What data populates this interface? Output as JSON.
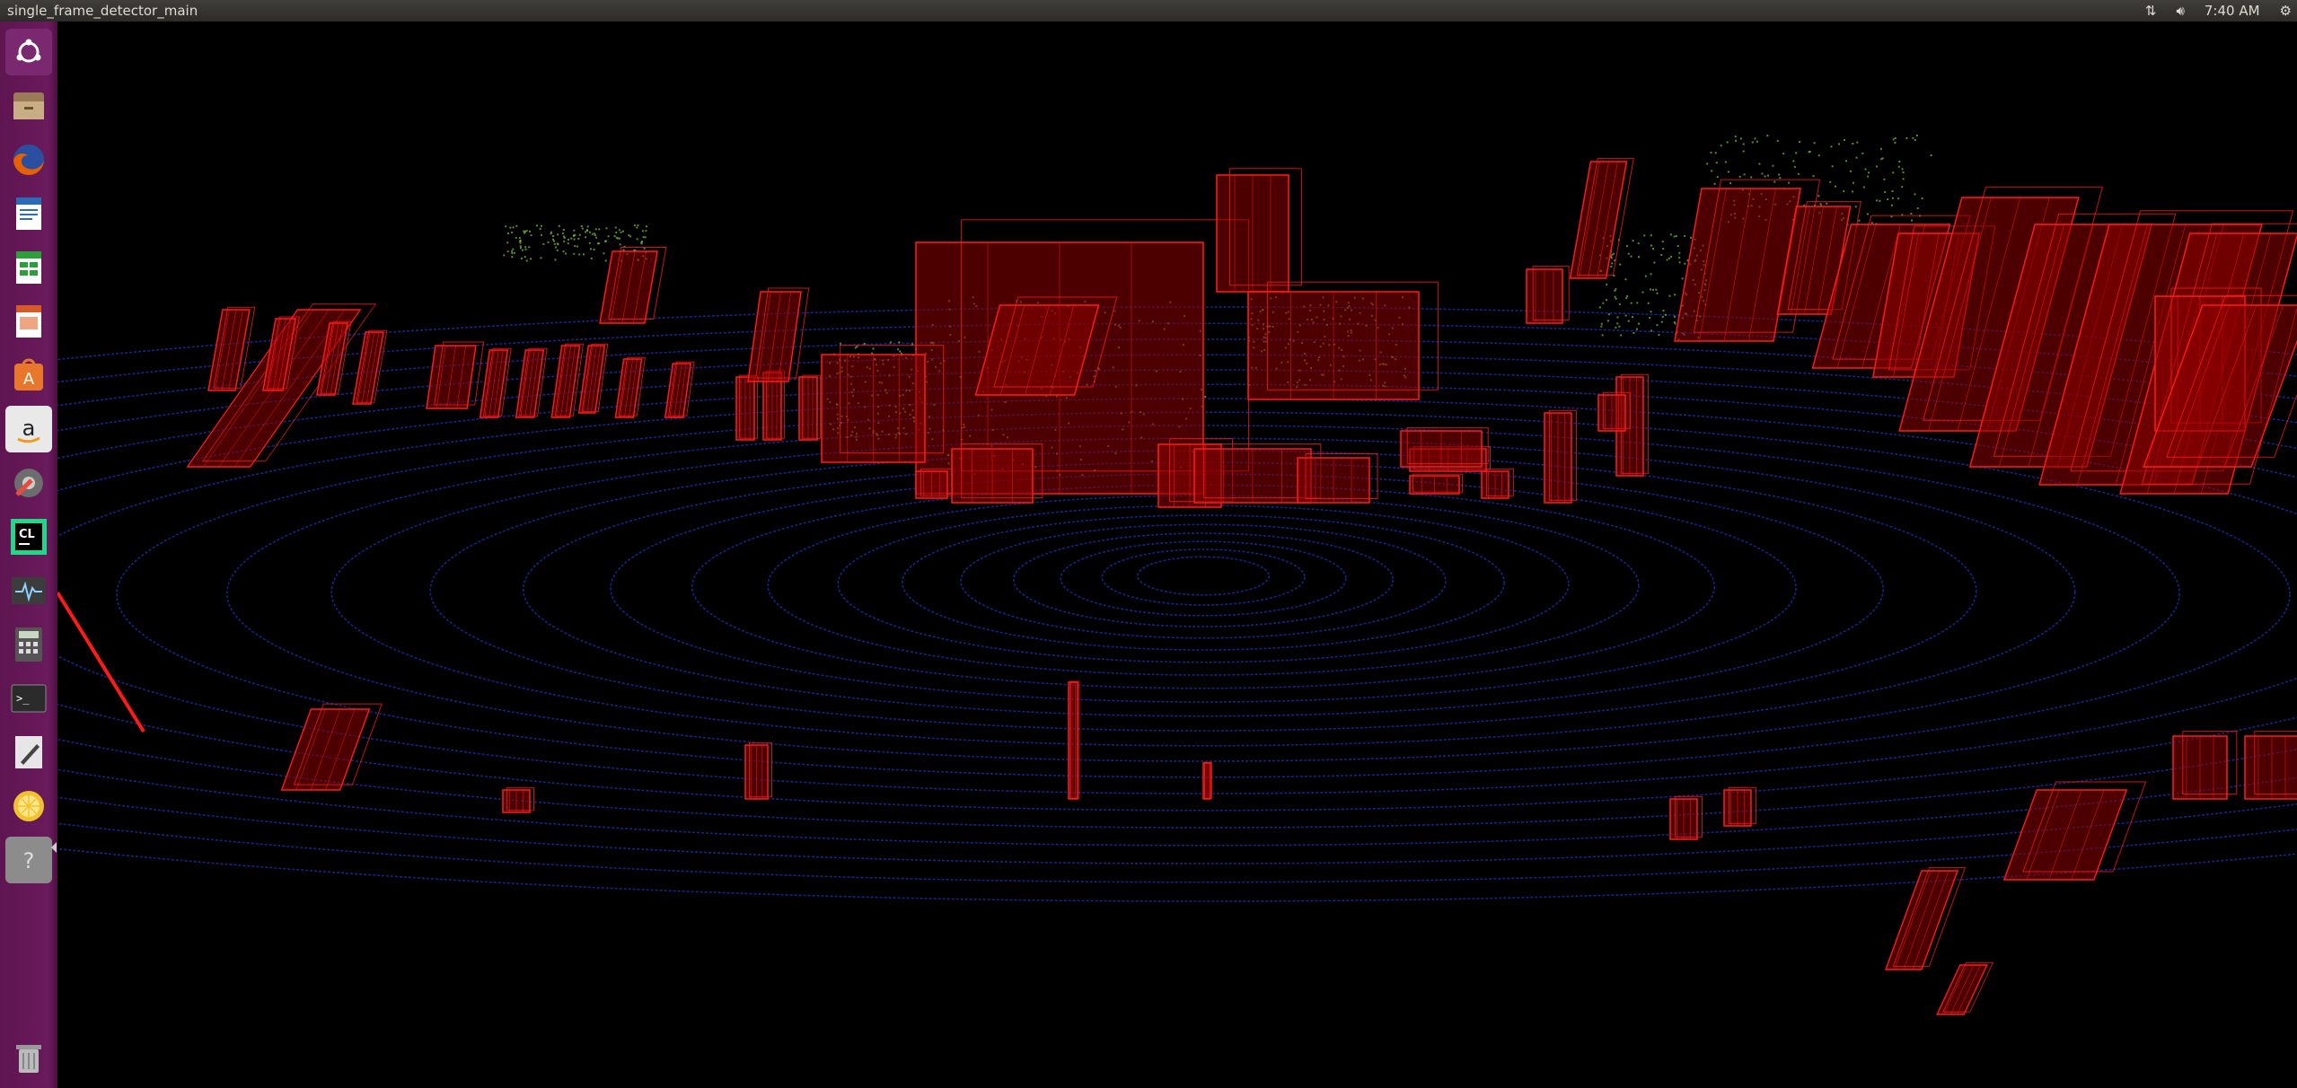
{
  "window": {
    "title": "single_frame_detector_main"
  },
  "indicators": {
    "network_icon": "network-arrows-icon",
    "volume_icon": "volume-icon",
    "clock": "7:40 AM",
    "settings_icon": "gear-icon"
  },
  "launcher": {
    "items": [
      {
        "name": "ubuntu-dash-icon",
        "color": "#7a2870"
      },
      {
        "name": "files-icon",
        "color": "#9a7b55"
      },
      {
        "name": "firefox-icon",
        "color": "#e66000"
      },
      {
        "name": "writer-icon",
        "color": "#2a6cb5"
      },
      {
        "name": "calc-icon",
        "color": "#2e9e3c"
      },
      {
        "name": "impress-icon",
        "color": "#d55a2a"
      },
      {
        "name": "software-center-icon",
        "color": "#e8762b"
      },
      {
        "name": "amazon-icon",
        "color": "#e9e9e9"
      },
      {
        "name": "system-settings-icon",
        "color": "#6d6d6d"
      },
      {
        "name": "clion-icon",
        "color": "#21d789"
      },
      {
        "name": "system-monitor-icon",
        "color": "#3c3c3c"
      },
      {
        "name": "calculator-icon",
        "color": "#555555"
      },
      {
        "name": "terminal-icon",
        "color": "#2b2b2b"
      },
      {
        "name": "text-editor-icon",
        "color": "#e6e6e6"
      },
      {
        "name": "lemon-app-icon",
        "color": "#f2c12e"
      },
      {
        "name": "help-icon",
        "color": "#8c8c8c"
      }
    ],
    "trash_icon": "trash-icon"
  },
  "colors": {
    "points_ground": "#1a2aa0",
    "points_object": "#7ec640",
    "box_stroke": "#ff1a1a",
    "box_fill": "#8a0000"
  }
}
